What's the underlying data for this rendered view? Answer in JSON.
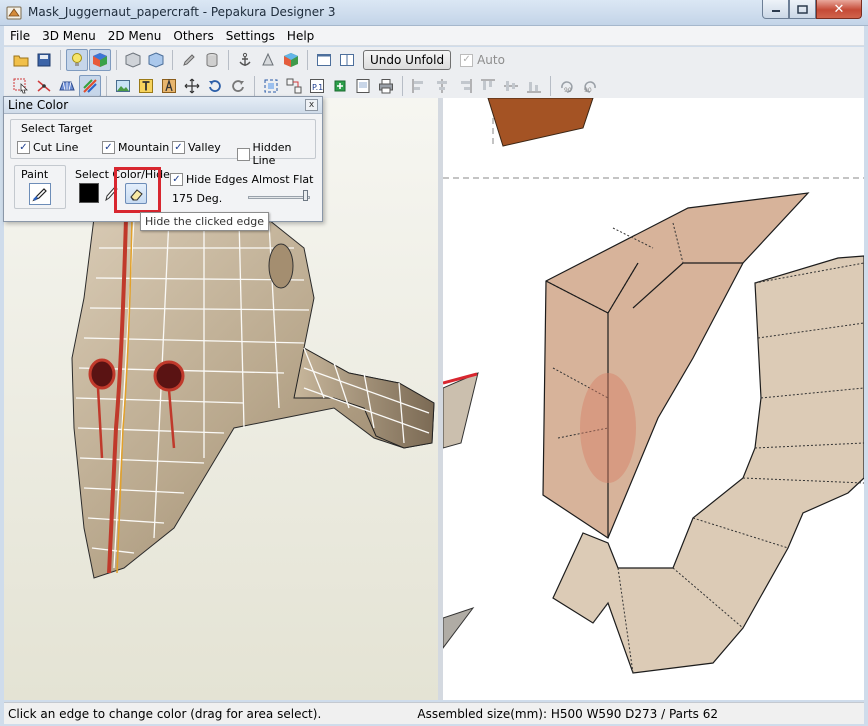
{
  "window": {
    "title": "Mask_Juggernaut_papercraft - Pepakura Designer 3"
  },
  "menu": [
    "File",
    "3D Menu",
    "2D Menu",
    "Others",
    "Settings",
    "Help"
  ],
  "toolbar": {
    "undo_label": "Undo Unfold",
    "auto_label": "Auto",
    "auto_checked": true
  },
  "dialog": {
    "title": "Line Color",
    "close_glyph": "x",
    "select_target": {
      "label": "Select Target",
      "options": [
        {
          "label": "Cut Line",
          "checked": true
        },
        {
          "label": "Mountain",
          "checked": true
        },
        {
          "label": "Valley",
          "checked": true
        },
        {
          "label": "Hidden Line",
          "checked": false
        }
      ]
    },
    "paint_label": "Paint",
    "select_color_label": "Select Color/Hide",
    "current_color": "#000000",
    "hide_flat_label": "Hide Edges Almost Flat",
    "hide_flat_checked": true,
    "angle_label": "175 Deg.",
    "angle_level": 1.0
  },
  "tooltip": "Hide the clicked edge",
  "status": {
    "left": "Click an edge to change color (drag for area select).",
    "right": "Assembled size(mm): H500 W590 D273 / Parts 62"
  },
  "colors": {
    "highlight": "#d8262f",
    "accent": "#c0392b"
  }
}
